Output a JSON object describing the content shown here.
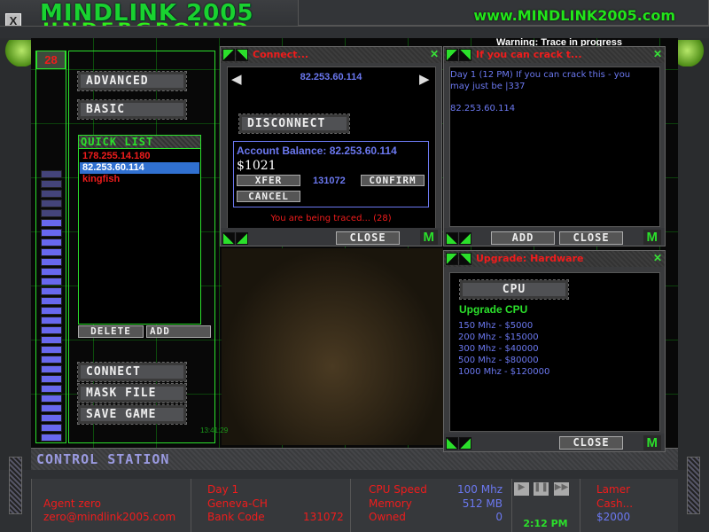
{
  "header": {
    "logo_line1": "MINDLINK 2005",
    "logo_line2": "UNDERGROUND",
    "url": "www.MINDLINK2005.com",
    "close": "X",
    "warning": "Warning: Trace in progress"
  },
  "left": {
    "counter": "28",
    "advanced": "ADVANCED",
    "basic": "BASIC",
    "quick_list_title": "QUICK LIST",
    "quick_list": [
      "178.255.14.180",
      "82.253.60.114",
      "kingfish"
    ],
    "selected_index": 1,
    "delete": "DELETE",
    "add": "ADD",
    "connect": "CONNECT",
    "mask_file": "MASK FILE",
    "save_game": "SAVE GAME",
    "control_station": "CONTROL STATION",
    "overlay_time": "13:41:29"
  },
  "connect_window": {
    "title": "Connect...",
    "ip": "82.253.60.114",
    "disconnect": "DISCONNECT",
    "balance_label": "Account Balance: 82.253.60.114",
    "balance": "$1021",
    "xfer": "XFER",
    "code": "131072",
    "confirm": "CONFIRM",
    "cancel": "CANCEL",
    "trace_msg": "You are being traced... (28)",
    "close": "CLOSE",
    "m": "M"
  },
  "crack_window": {
    "title": "If you can crack t...",
    "message": "Day 1 (12 PM) If you can crack this - you may just be |337",
    "ip": "82.253.60.114",
    "add": "ADD",
    "close": "CLOSE",
    "m": "M"
  },
  "upgrade_window": {
    "title": "Upgrade: Hardware",
    "cpu_tab": "CPU",
    "heading": "Upgrade CPU",
    "options": [
      "150 Mhz - $5000",
      "200 Mhz - $15000",
      "300 Mhz - $40000",
      "500 Mhz - $80000",
      "1000 Mhz - $120000"
    ],
    "close": "CLOSE",
    "m": "M"
  },
  "status": {
    "agent": "Agent zero",
    "email": "zero@mindlink2005.com",
    "day": "Day 1",
    "location": "Geneva-CH",
    "bank_code_label": "Bank Code",
    "bank_code": "131072",
    "cpu_label": "CPU Speed",
    "cpu": "100 Mhz",
    "memory_label": "Memory",
    "memory": "512 MB",
    "owned_label": "Owned",
    "owned": "0",
    "time": "2:12 PM",
    "rank": "Lamer",
    "cash_label": "Cash...",
    "cash": "$2000"
  },
  "colors": {
    "accent_green": "#2be02b",
    "alert_red": "#f01c1c",
    "info_blue": "#6b78f0"
  }
}
